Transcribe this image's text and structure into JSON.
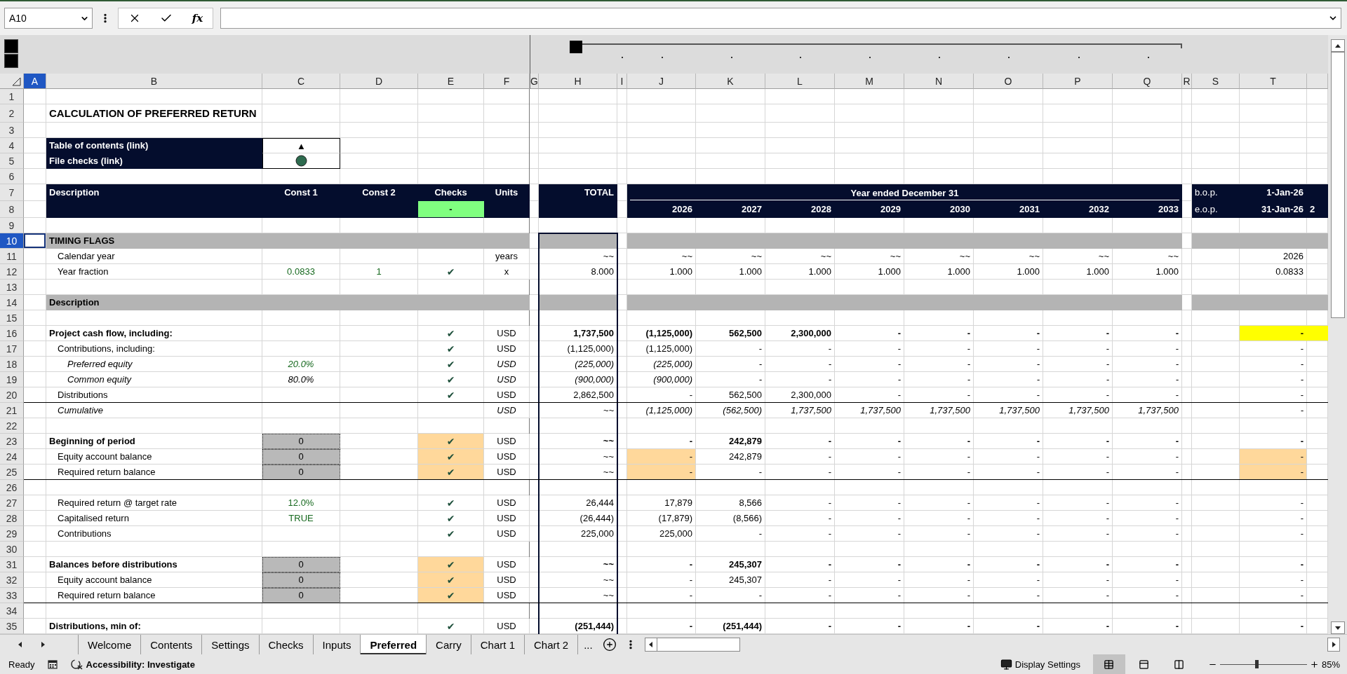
{
  "formula_bar": {
    "name_box": "A10",
    "function_label": "fx"
  },
  "columns": [
    {
      "letter": "A",
      "selected": true
    },
    {
      "letter": "B",
      "selected": false
    },
    {
      "letter": "C",
      "selected": false
    },
    {
      "letter": "D",
      "selected": false
    },
    {
      "letter": "E",
      "selected": false
    },
    {
      "letter": "F",
      "selected": false
    },
    {
      "letter": "G",
      "selected": false
    },
    {
      "letter": "H",
      "selected": false
    },
    {
      "letter": "I",
      "selected": false
    },
    {
      "letter": "J",
      "selected": false
    },
    {
      "letter": "K",
      "selected": false
    },
    {
      "letter": "L",
      "selected": false
    },
    {
      "letter": "M",
      "selected": false
    },
    {
      "letter": "N",
      "selected": false
    },
    {
      "letter": "O",
      "selected": false
    },
    {
      "letter": "P",
      "selected": false
    },
    {
      "letter": "Q",
      "selected": false
    },
    {
      "letter": "R",
      "selected": false
    },
    {
      "letter": "S",
      "selected": false
    },
    {
      "letter": "T",
      "selected": false
    }
  ],
  "rows": [
    {
      "number": "1",
      "kind": "blank",
      "selected": false
    },
    {
      "number": "2",
      "kind": "title",
      "selected": false,
      "label": "CALCULATION OF PREFERRED RETURN"
    },
    {
      "number": "3",
      "kind": "blank",
      "selected": false
    },
    {
      "number": "4",
      "kind": "link",
      "selected": false,
      "label": "Table of contents (link)",
      "marker": "▲"
    },
    {
      "number": "5",
      "kind": "link",
      "selected": false,
      "label": "File checks (link)",
      "checks_ok": true
    },
    {
      "number": "6",
      "kind": "blank",
      "selected": false
    },
    {
      "number": "7",
      "kind": "header",
      "selected": false,
      "label": "Description",
      "const_1": "Const 1",
      "const_2": "Const 2",
      "check": "Checks",
      "units": "Units",
      "total": "TOTAL",
      "banner": "Year ended December 31",
      "period": "b.o.p.",
      "month": "1-Jan-26"
    },
    {
      "number": "8",
      "kind": "header",
      "selected": false,
      "check": "-",
      "checks_passed": true,
      "annual": [
        "2026",
        "2027",
        "2028",
        "2029",
        "2030",
        "2031",
        "2032",
        "2033"
      ],
      "period": "e.o.p.",
      "month": "31-Jan-26",
      "overflow": "2"
    },
    {
      "number": "9",
      "kind": "blank",
      "selected": false
    },
    {
      "number": "10",
      "kind": "band",
      "selected": true,
      "label": "TIMING FLAGS"
    },
    {
      "number": "11",
      "kind": "item",
      "selected": false,
      "label": "Calendar year",
      "units": "years",
      "total": "~~",
      "annual": [
        "~~",
        "~~",
        "~~",
        "~~",
        "~~",
        "~~",
        "~~",
        "~~"
      ],
      "month": "2026"
    },
    {
      "number": "12",
      "kind": "item",
      "selected": false,
      "label": "Year fraction",
      "const_1": "0.0833",
      "const_2": "1",
      "check": "✔",
      "units": "x",
      "total": "8.000",
      "annual": [
        "1.000",
        "1.000",
        "1.000",
        "1.000",
        "1.000",
        "1.000",
        "1.000",
        "1.000"
      ],
      "month": "0.0833",
      "const_1_input": true,
      "const_2_input": true
    },
    {
      "number": "13",
      "kind": "blank",
      "selected": false
    },
    {
      "number": "14",
      "kind": "band",
      "selected": false,
      "label": "Description"
    },
    {
      "number": "15",
      "kind": "blank",
      "selected": false
    },
    {
      "number": "16",
      "kind": "heading",
      "selected": false,
      "label": "Project cash flow, including:",
      "check": "✔",
      "units": "USD",
      "total": "1,737,500",
      "annual": [
        "(1,125,000)",
        "562,500",
        "2,300,000",
        "-",
        "-",
        "-",
        "-",
        "-"
      ],
      "month": "-",
      "month_highlight": true
    },
    {
      "number": "17",
      "kind": "item",
      "selected": false,
      "label": "Contributions, including:",
      "check": "✔",
      "units": "USD",
      "total": "(1,125,000)",
      "annual": [
        "(1,125,000)",
        "-",
        "-",
        "-",
        "-",
        "-",
        "-",
        "-"
      ],
      "month": "-"
    },
    {
      "number": "18",
      "kind": "subitem",
      "selected": false,
      "label": "Preferred equity",
      "const_1": "20.0%",
      "check": "✔",
      "units": "USD",
      "total": "(225,000)",
      "annual": [
        "(225,000)",
        "-",
        "-",
        "-",
        "-",
        "-",
        "-",
        "-"
      ],
      "month": "-",
      "const_1_input": true
    },
    {
      "number": "19",
      "kind": "subitem",
      "selected": false,
      "label": "Common equity",
      "const_1": "80.0%",
      "check": "✔",
      "units": "USD",
      "total": "(900,000)",
      "annual": [
        "(900,000)",
        "-",
        "-",
        "-",
        "-",
        "-",
        "-",
        "-"
      ],
      "month": "-"
    },
    {
      "number": "20",
      "kind": "item",
      "selected": false,
      "label": "Distributions",
      "check": "✔",
      "units": "USD",
      "total": "2,862,500",
      "annual": [
        "-",
        "562,500",
        "2,300,000",
        "-",
        "-",
        "-",
        "-",
        "-"
      ],
      "month": "-",
      "rule_below": true
    },
    {
      "number": "21",
      "kind": "note",
      "selected": false,
      "label": "Cumulative",
      "units": "USD",
      "total": "~~",
      "annual": [
        "(1,125,000)",
        "(562,500)",
        "1,737,500",
        "1,737,500",
        "1,737,500",
        "1,737,500",
        "1,737,500",
        "1,737,500"
      ],
      "month": "-"
    },
    {
      "number": "22",
      "kind": "blank",
      "selected": false
    },
    {
      "number": "23",
      "kind": "heading",
      "selected": false,
      "label": "Beginning of period",
      "const_1": "0",
      "check": "✔",
      "units": "USD",
      "total": "~~",
      "annual": [
        "-",
        "242,879",
        "-",
        "-",
        "-",
        "-",
        "-",
        "-"
      ],
      "month": "-",
      "const_box": true,
      "check_flag": true
    },
    {
      "number": "24",
      "kind": "item",
      "selected": false,
      "label": "Equity account balance",
      "const_1": "0",
      "check": "✔",
      "units": "USD",
      "total": "~~",
      "annual": [
        "-",
        "242,879",
        "-",
        "-",
        "-",
        "-",
        "-",
        "-"
      ],
      "month": "-",
      "const_box": true,
      "check_flag": true,
      "year_flag": true,
      "month_flag": true
    },
    {
      "number": "25",
      "kind": "item",
      "selected": false,
      "label": "Required return balance",
      "const_1": "0",
      "check": "✔",
      "units": "USD",
      "total": "~~",
      "annual": [
        "-",
        "-",
        "-",
        "-",
        "-",
        "-",
        "-",
        "-"
      ],
      "month": "-",
      "const_box": true,
      "check_flag": true,
      "year_flag": true,
      "month_flag": true,
      "rule_below": true
    },
    {
      "number": "26",
      "kind": "blank",
      "selected": false
    },
    {
      "number": "27",
      "kind": "item",
      "selected": false,
      "label": "Required return @ target rate",
      "const_1": "12.0%",
      "check": "✔",
      "units": "USD",
      "total": "26,444",
      "annual": [
        "17,879",
        "8,566",
        "-",
        "-",
        "-",
        "-",
        "-",
        "-"
      ],
      "month": "-",
      "const_1_input": true
    },
    {
      "number": "28",
      "kind": "item",
      "selected": false,
      "label": "Capitalised return",
      "const_1": "TRUE",
      "check": "✔",
      "units": "USD",
      "total": "(26,444)",
      "annual": [
        "(17,879)",
        "(8,566)",
        "-",
        "-",
        "-",
        "-",
        "-",
        "-"
      ],
      "month": "-",
      "const_1_input": true
    },
    {
      "number": "29",
      "kind": "item",
      "selected": false,
      "label": "Contributions",
      "check": "✔",
      "units": "USD",
      "total": "225,000",
      "annual": [
        "225,000",
        "-",
        "-",
        "-",
        "-",
        "-",
        "-",
        "-"
      ],
      "month": "-"
    },
    {
      "number": "30",
      "kind": "blank",
      "selected": false
    },
    {
      "number": "31",
      "kind": "heading",
      "selected": false,
      "label": "Balances before distributions",
      "const_1": "0",
      "check": "✔",
      "units": "USD",
      "total": "~~",
      "annual": [
        "-",
        "245,307",
        "-",
        "-",
        "-",
        "-",
        "-",
        "-"
      ],
      "month": "-",
      "const_box": true,
      "check_flag": true
    },
    {
      "number": "32",
      "kind": "item",
      "selected": false,
      "label": "Equity account balance",
      "const_1": "0",
      "check": "✔",
      "units": "USD",
      "total": "~~",
      "annual": [
        "-",
        "245,307",
        "-",
        "-",
        "-",
        "-",
        "-",
        "-"
      ],
      "month": "-",
      "const_box": true,
      "check_flag": true
    },
    {
      "number": "33",
      "kind": "item",
      "selected": false,
      "label": "Required return balance",
      "const_1": "0",
      "check": "✔",
      "units": "USD",
      "total": "~~",
      "annual": [
        "-",
        "-",
        "-",
        "-",
        "-",
        "-",
        "-",
        "-"
      ],
      "month": "-",
      "const_box": true,
      "check_flag": true,
      "rule_below": true
    },
    {
      "number": "34",
      "kind": "blank",
      "selected": false
    },
    {
      "number": "35",
      "kind": "heading",
      "selected": false,
      "label": "Distributions, min of:",
      "check": "✔",
      "units": "USD",
      "total": "(251,444)",
      "annual": [
        "-",
        "(251,444)",
        "-",
        "-",
        "-",
        "-",
        "-",
        "-"
      ],
      "month": "-"
    }
  ],
  "sheet_tabs": [
    {
      "label": "Welcome",
      "selected": false
    },
    {
      "label": "Contents",
      "selected": false
    },
    {
      "label": "Settings",
      "selected": false
    },
    {
      "label": "Checks",
      "selected": false
    },
    {
      "label": "Inputs",
      "selected": false
    },
    {
      "label": "Preferred",
      "selected": true
    },
    {
      "label": "Carry",
      "selected": false
    },
    {
      "label": "Chart 1",
      "selected": false
    },
    {
      "label": "Chart 2",
      "selected": false
    }
  ],
  "more_tabs": "...",
  "status_bar": {
    "mode": "Ready",
    "accessibility": "Accessibility: Investigate",
    "display_settings": "Display Settings",
    "views": [
      {
        "kind": "normal",
        "selected": true
      },
      {
        "kind": "page-layout",
        "selected": false
      },
      {
        "kind": "page-break",
        "selected": false
      }
    ],
    "zoom": {
      "level": 0.42,
      "reading": "85%"
    }
  }
}
